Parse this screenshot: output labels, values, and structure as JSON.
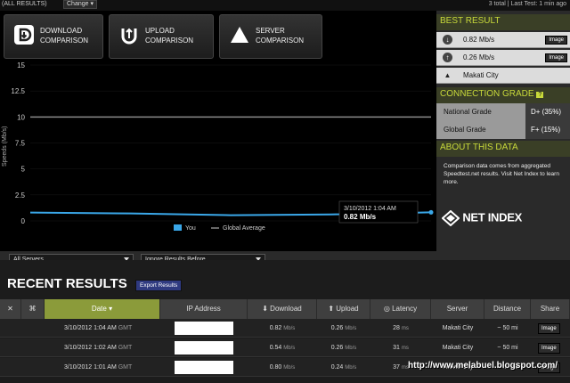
{
  "topbar": {
    "scope": "(ALL RESULTS)",
    "change": "Change",
    "status": "3 total | Last Test: 1 min ago"
  },
  "compare": [
    {
      "line1": "DOWNLOAD",
      "line2": "COMPARISON",
      "icon": "download-icon"
    },
    {
      "line1": "UPLOAD",
      "line2": "COMPARISON",
      "icon": "upload-icon"
    },
    {
      "line1": "SERVER",
      "line2": "COMPARISON",
      "icon": "server-icon"
    }
  ],
  "chart_data": {
    "type": "line",
    "ylabel": "Speeds (Mb/s)",
    "ylim": [
      0,
      15
    ],
    "yticks": [
      0,
      2.5,
      5,
      7.5,
      10,
      12.5,
      15
    ],
    "series": [
      {
        "name": "You",
        "color": "#3aa7e8",
        "values": [
          0.8,
          0.72,
          0.55,
          0.62,
          0.82
        ]
      },
      {
        "name": "Global Average",
        "color": "#8a8a8a",
        "values": [
          10,
          10,
          10,
          10,
          10
        ]
      }
    ],
    "tooltip": {
      "date": "3/10/2012 1:04 AM",
      "value": "0.82",
      "unit": "Mb/s"
    }
  },
  "controls": {
    "servers": "All Servers",
    "ignore": "Ignore Results Before"
  },
  "best": {
    "title": "BEST RESULT",
    "download": "0.82",
    "upload": "0.26",
    "unit": "Mb/s",
    "server": "Makati City",
    "image_label": "Image"
  },
  "grade": {
    "title": "CONNECTION GRADE",
    "help": "?",
    "rows": [
      {
        "name": "National Grade",
        "value": "D+ (35%)"
      },
      {
        "name": "Global Grade",
        "value": "F+ (15%)"
      }
    ]
  },
  "about": {
    "title": "ABOUT THIS DATA",
    "text": "Comparison data comes from aggregated Speedtest.net results. Visit Net Index to learn more.",
    "logo": "NET INDEX"
  },
  "recent": {
    "title": "RECENT RESULTS",
    "export": "Export Results",
    "headers": [
      "Date",
      "IP Address",
      "Download",
      "Upload",
      "Latency",
      "Server",
      "Distance",
      "Share"
    ],
    "rows": [
      {
        "date": "3/10/2012 1:04 AM",
        "tz": "GMT",
        "down": "0.82",
        "up": "0.26",
        "unit": "Mb/s",
        "latency": "28",
        "lat_unit": "ms",
        "server": "Makati City",
        "distance": "~ 50 mi",
        "share": "Image"
      },
      {
        "date": "3/10/2012 1:02 AM",
        "tz": "GMT",
        "down": "0.54",
        "up": "0.26",
        "unit": "Mb/s",
        "latency": "31",
        "lat_unit": "ms",
        "server": "Makati City",
        "distance": "~ 50 mi",
        "share": "Image"
      },
      {
        "date": "3/10/2012 1:01 AM",
        "tz": "GMT",
        "down": "0.80",
        "up": "0.24",
        "unit": "Mb/s",
        "latency": "37",
        "lat_unit": "ms",
        "server": "Makati City",
        "distance": "~ 50 mi",
        "share": "Image"
      }
    ]
  },
  "watermark": "http://www.melabuel.blogspot.com/"
}
